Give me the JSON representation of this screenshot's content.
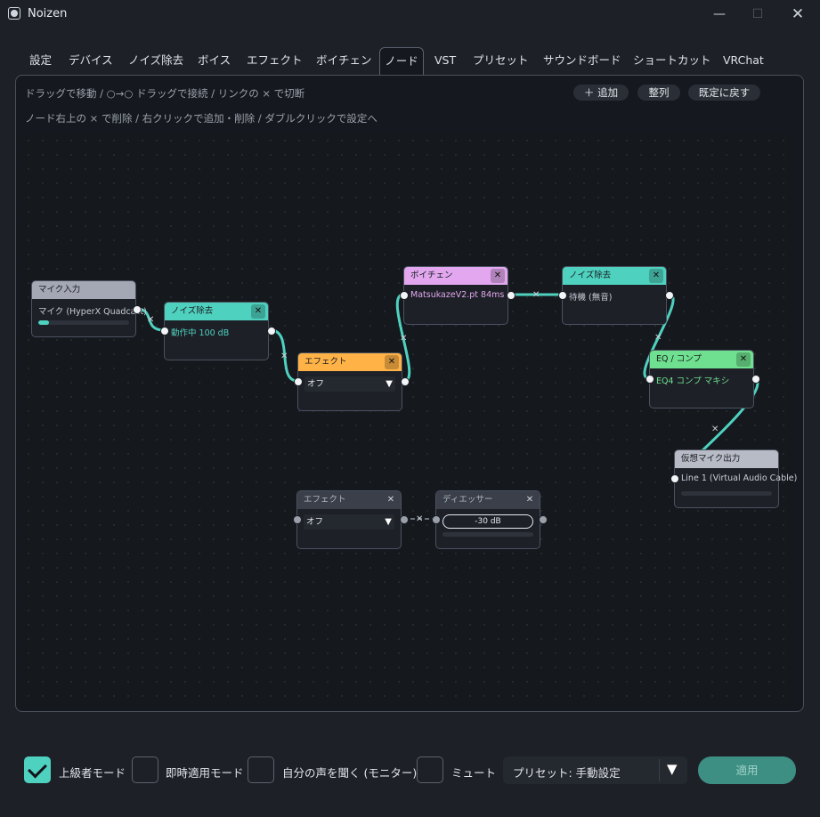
{
  "window": {
    "title": "Noizen",
    "min": "—",
    "max": "☐",
    "close": "✕"
  },
  "tabs": [
    {
      "label": "設定"
    },
    {
      "label": "デバイス"
    },
    {
      "label": "ノイズ除去"
    },
    {
      "label": "ボイス"
    },
    {
      "label": "エフェクト"
    },
    {
      "label": "ボイチェン"
    },
    {
      "label": "ノード",
      "active": true
    },
    {
      "label": "VST"
    },
    {
      "label": "プリセット"
    },
    {
      "label": "サウンドボード"
    },
    {
      "label": "ショートカット"
    },
    {
      "label": "VRChat"
    }
  ],
  "toolbar": {
    "hint1": "ドラッグで移動 / ○→○ ドラッグで接続 / リンクの × で切断",
    "hint2": "ノード右上の × で削除 / 右クリックで追加・削除 / ダブルクリックで設定へ",
    "add": "＋ 追加",
    "arrange": "整列",
    "reset": "既定に戻す"
  },
  "nodes": {
    "mic": {
      "title": "マイク入力",
      "device": "マイク (HyperX Quadcast)",
      "level": 0.12
    },
    "denoise1": {
      "title": "ノイズ除去",
      "status": "動作中  100 dB"
    },
    "effect1": {
      "title": "エフェクト",
      "value": "オフ"
    },
    "voicechanger": {
      "title": "ボイチェン",
      "model": "MatsukazeV2.pt  84ms"
    },
    "denoise2": {
      "title": "ノイズ除去",
      "status": "待機 (無音)"
    },
    "eq": {
      "title": "EQ / コンプ",
      "value": "EQ4 コンプ マキシ"
    },
    "vmic": {
      "title": "仮想マイク出力",
      "device": "Line 1 (Virtual Audio Cable)",
      "level": 0
    },
    "effect2": {
      "title": "エフェクト",
      "value": "オフ"
    },
    "deesser": {
      "title": "ディエッサー",
      "value": "-30 dB",
      "level": 0
    }
  },
  "colors": {
    "accent": "#4fd1bf",
    "mic_header": "#a4a8b5",
    "denoise_header": "#4fd1bf",
    "effect_header": "#ffb347",
    "voicechanger_header": "#e2a7ef",
    "eq_header": "#6fe08f",
    "vmic_header": "#b7bbc6"
  },
  "footer": {
    "advanced": {
      "label": "上級者モード",
      "checked": true
    },
    "instant": {
      "label": "即時適用モード",
      "checked": false
    },
    "monitor": {
      "label": "自分の声を聞く (モニター)",
      "checked": false
    },
    "mute": {
      "label": "ミュート",
      "checked": false
    },
    "preset": "プリセット: 手動設定",
    "apply": "適用"
  }
}
